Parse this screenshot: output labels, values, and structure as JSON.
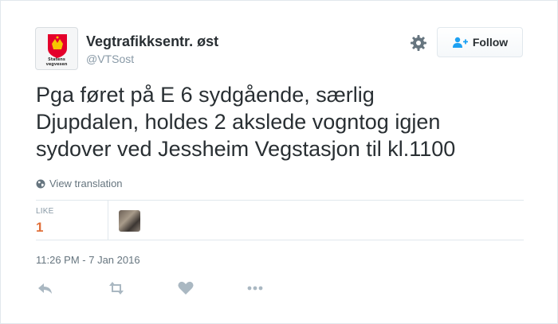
{
  "user": {
    "name": "Vegtrafikksentr. øst",
    "handle": "@VTSost",
    "avatar_text": "Statens vegvesen"
  },
  "follow_button": {
    "label": "Follow"
  },
  "tweet": {
    "lines": [
      "Pga føret på E 6 sydgående, særlig",
      "Djupdalen, holdes 2 akslede vogntog igjen",
      "sydover ved Jessheim Vegstasjon til kl.1100"
    ]
  },
  "translate_link": "View translation",
  "stats": {
    "like_label": "LIKE",
    "like_count": "1"
  },
  "timestamp": "11:26 PM - 7 Jan 2016",
  "colors": {
    "like_count": "#e1703a",
    "text": "#292f33",
    "muted": "#8899a6",
    "border": "#e1e8ed",
    "logo_red": "#e4002b"
  },
  "icons": {
    "gear": "gear-icon",
    "follow": "add-user-icon",
    "globe": "globe-icon",
    "reply": "reply-icon",
    "retweet": "retweet-icon",
    "like": "heart-icon",
    "more": "more-icon"
  }
}
